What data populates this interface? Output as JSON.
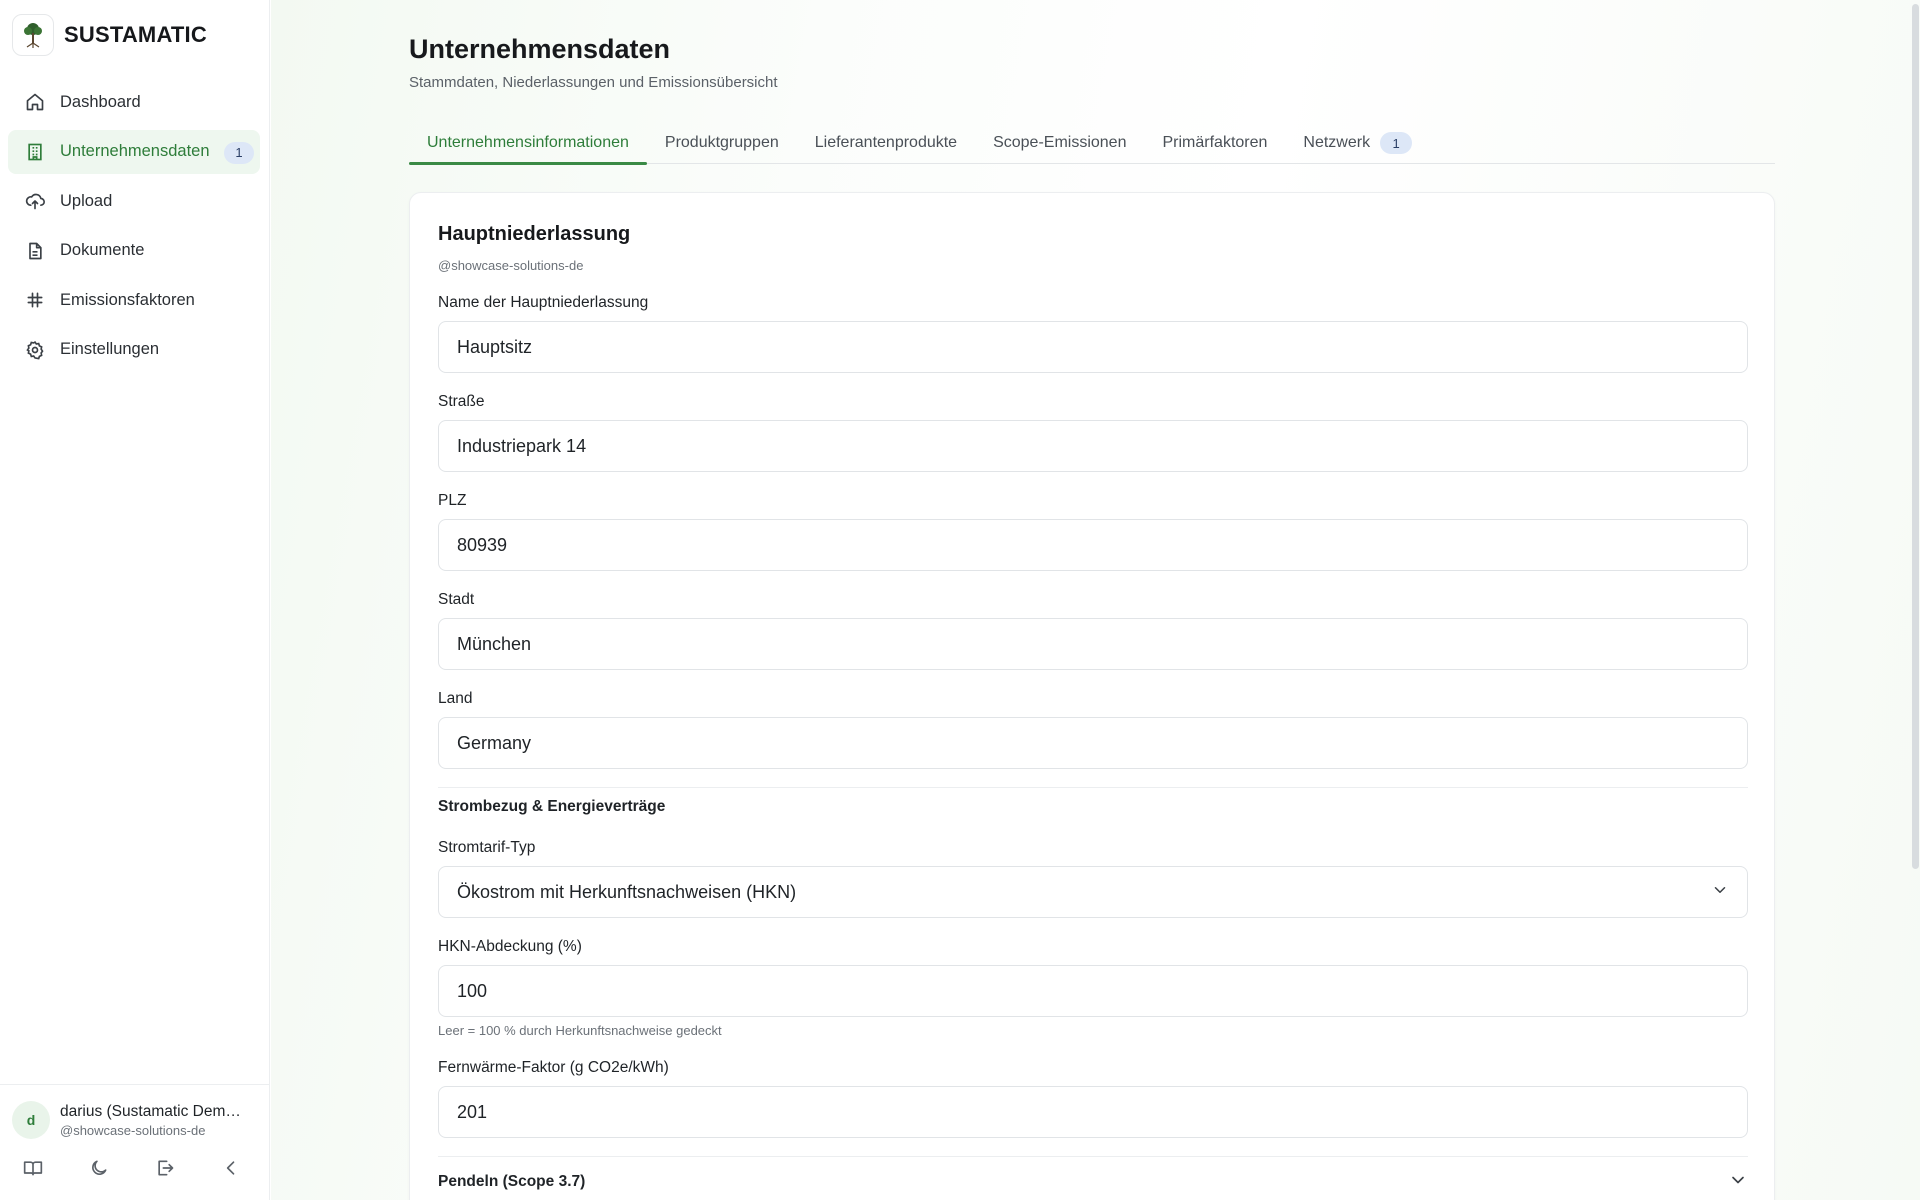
{
  "brand": {
    "name": "SUSTAMATIC"
  },
  "sidebar": {
    "items": [
      {
        "label": "Dashboard",
        "icon": "home-icon"
      },
      {
        "label": "Unternehmensdaten",
        "icon": "building-icon",
        "badge": "1",
        "active": true
      },
      {
        "label": "Upload",
        "icon": "cloud-upload-icon"
      },
      {
        "label": "Dokumente",
        "icon": "document-icon"
      },
      {
        "label": "Emissionsfaktoren",
        "icon": "hash-icon"
      },
      {
        "label": "Einstellungen",
        "icon": "gear-icon"
      }
    ],
    "user": {
      "initial": "d",
      "name": "darius (Sustamatic Dem…",
      "handle": "@showcase-solutions-de"
    }
  },
  "page": {
    "title": "Unternehmensdaten",
    "subtitle": "Stammdaten, Niederlassungen und Emissionsübersicht"
  },
  "tabs": [
    {
      "label": "Unternehmensinformationen",
      "active": true
    },
    {
      "label": "Produktgruppen"
    },
    {
      "label": "Lieferantenprodukte"
    },
    {
      "label": "Scope-Emissionen"
    },
    {
      "label": "Primärfaktoren"
    },
    {
      "label": "Netzwerk",
      "badge": "1"
    }
  ],
  "card": {
    "title": "Hauptniederlassung",
    "subtitle": "@showcase-solutions-de",
    "fields": {
      "name": {
        "label": "Name der Hauptniederlassung",
        "value": "Hauptsitz"
      },
      "street": {
        "label": "Straße",
        "value": "Industriepark 14"
      },
      "zip": {
        "label": "PLZ",
        "value": "80939"
      },
      "city": {
        "label": "Stadt",
        "value": "München"
      },
      "country": {
        "label": "Land",
        "value": "Germany"
      }
    },
    "energy_section": {
      "title": "Strombezug & Energieverträge",
      "tariff": {
        "label": "Stromtarif-Typ",
        "value": "Ökostrom mit Herkunftsnachweisen (HKN)"
      },
      "hkn": {
        "label": "HKN-Abdeckung (%)",
        "value": "100",
        "hint": "Leer = 100 % durch Herkunftsnachweise gedeckt"
      },
      "district_heating": {
        "label": "Fernwärme-Faktor (g CO2e/kWh)",
        "value": "201"
      }
    },
    "commute_section": {
      "title": "Pendeln (Scope 3.7)"
    }
  },
  "colors": {
    "accent": "#2e7d3a",
    "active_bg": "#eef7ef",
    "badge_bg": "#dde7f7"
  }
}
